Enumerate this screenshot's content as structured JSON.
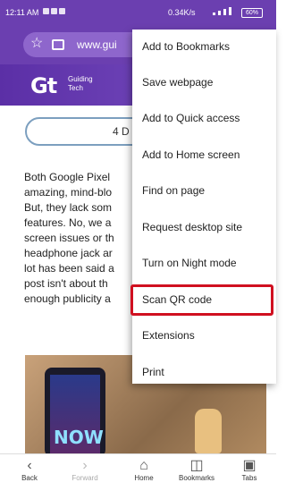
{
  "status_bar": {
    "time": "12:11 AM",
    "speed": "0.34K/s",
    "battery": "60%"
  },
  "url_bar": {
    "url": "www.gui"
  },
  "site_header": {
    "logo": "Gt",
    "brand_line1": "Guiding",
    "brand_line2": "Tech"
  },
  "read_button": {
    "label": "4 D"
  },
  "article_lines": [
    "Both Google Pixel",
    "amazing, mind-blo",
    "But, they lack som",
    "features. No, we a",
    "screen issues or th",
    "headphone jack ar",
    "lot has been said a",
    "post isn't about th",
    "enough publicity a"
  ],
  "ad_image": {
    "text": "NOW"
  },
  "menu": {
    "items": [
      "Add to Bookmarks",
      "Save webpage",
      "Add to Quick access",
      "Add to Home screen",
      "Find on page",
      "Request desktop site",
      "Turn on Night mode",
      "Scan QR code",
      "Extensions",
      "Print"
    ],
    "highlighted": "Scan QR code",
    "highlight_color": "#d01020"
  },
  "bottom_nav": {
    "back": "Back",
    "forward": "Forward",
    "home": "Home",
    "bookmarks": "Bookmarks",
    "tabs": "Tabs"
  },
  "colors": {
    "brand": "#6b3fb0"
  }
}
